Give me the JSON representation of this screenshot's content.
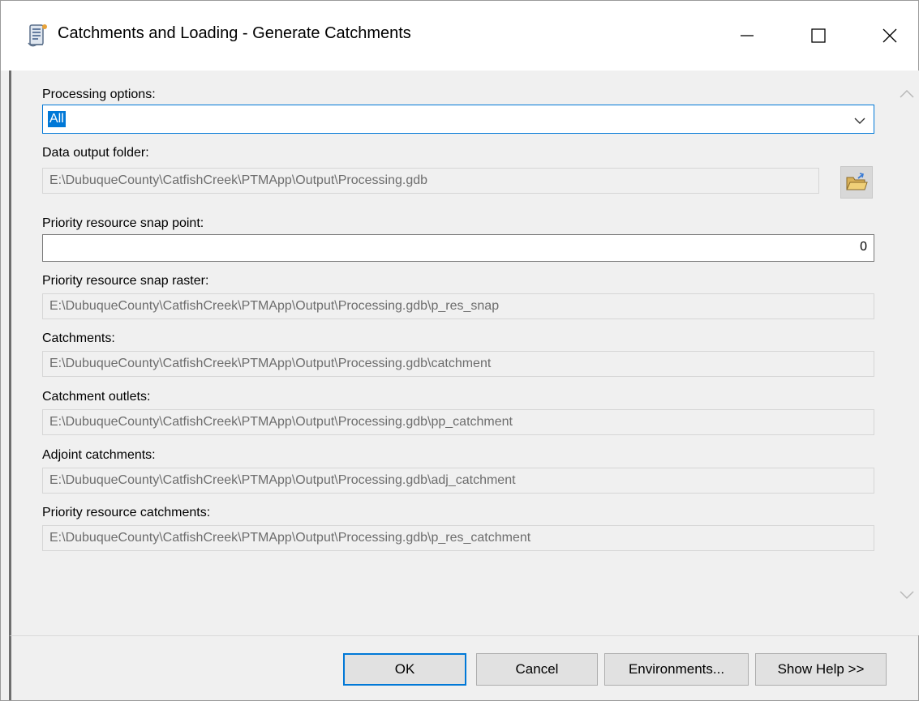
{
  "window": {
    "title": "Catchments and Loading - Generate Catchments",
    "icon": "script-tool-icon"
  },
  "form": {
    "processing_options": {
      "label": "Processing options:",
      "value": "All"
    },
    "data_output_folder": {
      "label": "Data output folder:",
      "value": "E:\\DubuqueCounty\\CatfishCreek\\PTMApp\\Output\\Processing.gdb"
    },
    "snap_point": {
      "label": "Priority resource snap point:",
      "value": "0"
    },
    "snap_raster": {
      "label": "Priority resource snap raster:",
      "value": "E:\\DubuqueCounty\\CatfishCreek\\PTMApp\\Output\\Processing.gdb\\p_res_snap"
    },
    "catchments": {
      "label": "Catchments:",
      "value": "E:\\DubuqueCounty\\CatfishCreek\\PTMApp\\Output\\Processing.gdb\\catchment"
    },
    "catchment_outlets": {
      "label": "Catchment outlets:",
      "value": "E:\\DubuqueCounty\\CatfishCreek\\PTMApp\\Output\\Processing.gdb\\pp_catchment"
    },
    "adjoint_catchments": {
      "label": "Adjoint catchments:",
      "value": "E:\\DubuqueCounty\\CatfishCreek\\PTMApp\\Output\\Processing.gdb\\adj_catchment"
    },
    "priority_resource_catchments": {
      "label": "Priority resource catchments:",
      "value": "E:\\DubuqueCounty\\CatfishCreek\\PTMApp\\Output\\Processing.gdb\\p_res_catchment"
    }
  },
  "buttons": {
    "ok": "OK",
    "cancel": "Cancel",
    "environments": "Environments...",
    "show_help": "Show Help >>"
  },
  "colors": {
    "accent": "#0078d7",
    "disabled_text": "#6d6d6d",
    "background": "#f0f0f0"
  }
}
